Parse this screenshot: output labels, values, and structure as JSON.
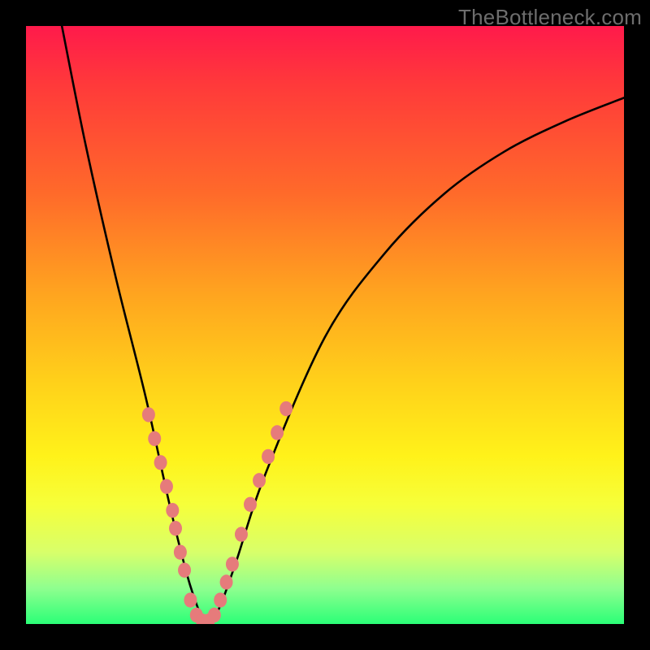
{
  "watermark": "TheBottleneck.com",
  "chart_data": {
    "type": "line",
    "title": "",
    "xlabel": "",
    "ylabel": "",
    "xlim": [
      0,
      100
    ],
    "ylim": [
      0,
      100
    ],
    "series": [
      {
        "name": "bottleneck-curve",
        "x": [
          6,
          10,
          15,
          20,
          24,
          27,
          29,
          30,
          32,
          35,
          40,
          50,
          60,
          70,
          80,
          90,
          100
        ],
        "y": [
          100,
          80,
          58,
          38,
          20,
          8,
          2,
          0,
          2,
          10,
          25,
          48,
          62,
          72,
          79,
          84,
          88
        ]
      }
    ],
    "highlight_segments": [
      {
        "name": "left-dots",
        "x": [
          20.5,
          21.5,
          22.5,
          23.5,
          24.5,
          25.0,
          25.8,
          26.5
        ],
        "y": [
          35,
          31,
          27,
          23,
          19,
          16,
          12,
          9
        ]
      },
      {
        "name": "trough-dots",
        "x": [
          27.5,
          28.5,
          29.5,
          30.5,
          31.5,
          32.5,
          33.5
        ],
        "y": [
          4,
          1.5,
          0.5,
          0.5,
          1.5,
          4,
          7
        ]
      },
      {
        "name": "right-dots",
        "x": [
          34.5,
          36.0,
          37.5,
          39.0,
          40.5,
          42.0,
          43.5
        ],
        "y": [
          10,
          15,
          20,
          24,
          28,
          32,
          36
        ]
      }
    ],
    "colors": {
      "curve": "#000000",
      "dots": "#e67b7b"
    }
  }
}
